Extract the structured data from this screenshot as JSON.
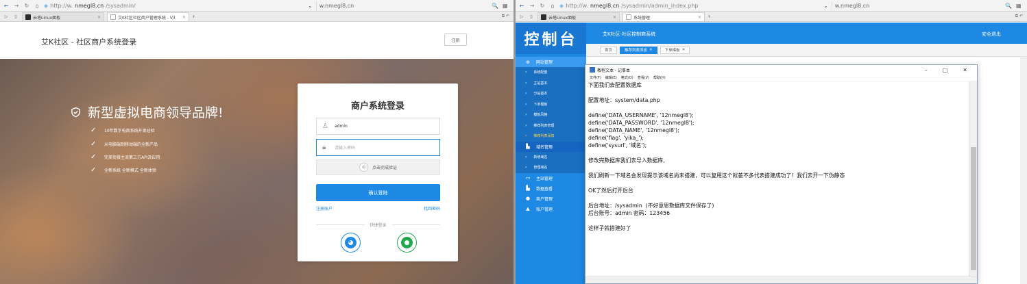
{
  "left_browser": {
    "url_prefix": "http://w.",
    "url_domain": "nmegl8.cn",
    "url_path": "/sysadmin/",
    "search_text": "w.nmegl8.cn",
    "tabs": [
      {
        "label": "云塔Linux面板",
        "active": false
      },
      {
        "label": "艾K社区社区商户管理系统 - V3",
        "active": true
      }
    ]
  },
  "right_browser": {
    "url_prefix": "http://w.",
    "url_domain": "nmegl8.cn",
    "url_path": "/sysadmin/admin_index.php",
    "search_text": "w.nmegl8.cn",
    "tabs": [
      {
        "label": "云塔Linux面板",
        "active": false
      },
      {
        "label": "系统管理",
        "active": true
      }
    ]
  },
  "login_page": {
    "header_title": "艾K社区 - 社区商户系统登录",
    "register_label": "注册",
    "slogan": "新型虚拟电商领导品牌!",
    "features": [
      "10年数字电商系统开发经验",
      "从电脑端到移动端的全新产品",
      "完美衔接主流第三方API及应用",
      "全新系统 全新模式 全新体验"
    ],
    "card_title": "商户系统登录",
    "username_value": "admin",
    "password_placeholder": "请输入密码",
    "verify_label": "点击完成验证",
    "submit_label": "确认登陆",
    "register_link": "注册账户",
    "forgot_link": "找回密码",
    "quick_login": "快捷登录"
  },
  "admin": {
    "logo": "控制台",
    "system_title": "艾K社区-社区控制商系统",
    "logout": "安全退出",
    "crumbs": [
      {
        "label": "首页",
        "active": false
      },
      {
        "label": "推荐列表添加",
        "active": true
      },
      {
        "label": "下单模板",
        "active": false
      }
    ],
    "menu": [
      {
        "type": "group",
        "label": "网站管理",
        "icon": "⊕",
        "style": "hl"
      },
      {
        "type": "sub",
        "label": "系统配置"
      },
      {
        "type": "sub",
        "label": "主站基本"
      },
      {
        "type": "sub",
        "label": "分站基本"
      },
      {
        "type": "sub",
        "label": "下单模板"
      },
      {
        "type": "sub",
        "label": "模板风格"
      },
      {
        "type": "sub",
        "label": "推荐列表管理"
      },
      {
        "type": "sub",
        "label": "推荐列表添加",
        "style": "yl"
      },
      {
        "type": "group",
        "label": "域名管理",
        "icon": "▙",
        "style": "sel"
      },
      {
        "type": "sub",
        "label": "新增域名"
      },
      {
        "type": "sub",
        "label": "管理域名"
      },
      {
        "type": "group",
        "label": "主站管理",
        "icon": "▭"
      },
      {
        "type": "group",
        "label": "数据查看",
        "icon": "▙"
      },
      {
        "type": "group",
        "label": "商户管理",
        "icon": "●"
      },
      {
        "type": "group",
        "label": "账户管理",
        "icon": "▲"
      }
    ]
  },
  "notepad": {
    "title": "教程文本 - 记事本",
    "menus": [
      "文件(F)",
      "编辑(E)",
      "格式(O)",
      "查看(V)",
      "帮助(H)"
    ],
    "lines": [
      "下面我们去配置数据库",
      "",
      "配置地址：system/data.php",
      "",
      "define('DATA_USERNAME', '12nmegl8');",
      "define('DATA_PASSWORD', '12nmegl8');",
      "define('DATA_NAME', '12nmegl8');",
      "define('flag', 'yika_');",
      "define('sysurl', '域名');",
      "",
      "修改完数据库我们去导入数据库,",
      "",
      "我们刷新一下域名会发现提示该域名尚未搭建，可以复用这个就差不多代表搭建成功了！我们去开一下伪静态",
      "",
      "OK了然后打开后台",
      "",
      "后台地址：/sysadmin  (不好意思数据库文件保存了)",
      "后台账号：admin 密码：123456",
      "",
      "这样子就搭建好了"
    ]
  }
}
